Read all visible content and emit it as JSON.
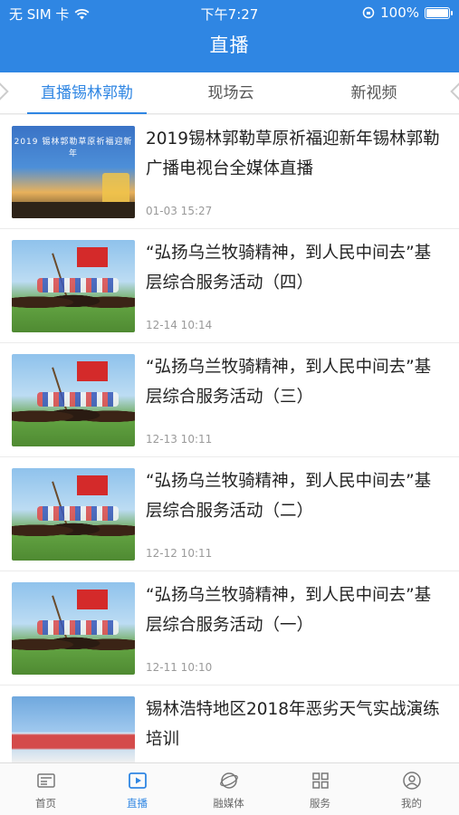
{
  "status_bar": {
    "carrier": "无 SIM 卡",
    "time": "下午7:27",
    "battery": "100%"
  },
  "page": {
    "title": "直播"
  },
  "tabs": [
    {
      "label": "直播锡林郭勒",
      "active": true
    },
    {
      "label": "现场云",
      "active": false
    },
    {
      "label": "新视频",
      "active": false
    }
  ],
  "items": [
    {
      "title": "2019锡林郭勒草原祈福迎新年锡林郭勒广播电视台全媒体直播",
      "date": "01-03 15:27",
      "thumb_text": "2019 锡林郭勒草原祈福迎新年"
    },
    {
      "title": "“弘扬乌兰牧骑精神，到人民中间去”基层综合服务活动（四）",
      "date": "12-14 10:14"
    },
    {
      "title": "“弘扬乌兰牧骑精神，到人民中间去”基层综合服务活动（三）",
      "date": "12-13 10:11"
    },
    {
      "title": "“弘扬乌兰牧骑精神，到人民中间去”基层综合服务活动（二）",
      "date": "12-12 10:11"
    },
    {
      "title": "“弘扬乌兰牧骑精神，到人民中间去”基层综合服务活动（一）",
      "date": "12-11 10:10"
    },
    {
      "title": "锡林浩特地区2018年恶劣天气实战演练培训",
      "date": ""
    }
  ],
  "tabbar": [
    {
      "label": "首页",
      "icon": "home-icon",
      "active": false
    },
    {
      "label": "直播",
      "icon": "play-icon",
      "active": true
    },
    {
      "label": "融媒体",
      "icon": "globe-icon",
      "active": false
    },
    {
      "label": "服务",
      "icon": "grid-icon",
      "active": false
    },
    {
      "label": "我的",
      "icon": "user-icon",
      "active": false
    }
  ],
  "colors": {
    "accent": "#2f86e3",
    "header": "#2f86e3",
    "inactive": "#666666"
  }
}
